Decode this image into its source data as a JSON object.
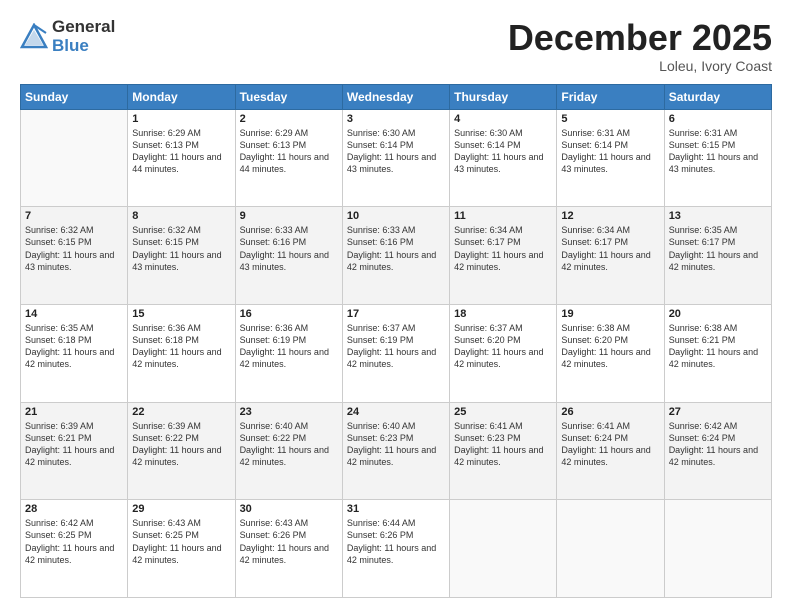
{
  "logo": {
    "general": "General",
    "blue": "Blue"
  },
  "header": {
    "month": "December 2025",
    "location": "Loleu, Ivory Coast"
  },
  "weekdays": [
    "Sunday",
    "Monday",
    "Tuesday",
    "Wednesday",
    "Thursday",
    "Friday",
    "Saturday"
  ],
  "weeks": [
    [
      {
        "day": "",
        "sunrise": "",
        "sunset": "",
        "daylight": ""
      },
      {
        "day": "1",
        "sunrise": "Sunrise: 6:29 AM",
        "sunset": "Sunset: 6:13 PM",
        "daylight": "Daylight: 11 hours and 44 minutes."
      },
      {
        "day": "2",
        "sunrise": "Sunrise: 6:29 AM",
        "sunset": "Sunset: 6:13 PM",
        "daylight": "Daylight: 11 hours and 44 minutes."
      },
      {
        "day": "3",
        "sunrise": "Sunrise: 6:30 AM",
        "sunset": "Sunset: 6:14 PM",
        "daylight": "Daylight: 11 hours and 43 minutes."
      },
      {
        "day": "4",
        "sunrise": "Sunrise: 6:30 AM",
        "sunset": "Sunset: 6:14 PM",
        "daylight": "Daylight: 11 hours and 43 minutes."
      },
      {
        "day": "5",
        "sunrise": "Sunrise: 6:31 AM",
        "sunset": "Sunset: 6:14 PM",
        "daylight": "Daylight: 11 hours and 43 minutes."
      },
      {
        "day": "6",
        "sunrise": "Sunrise: 6:31 AM",
        "sunset": "Sunset: 6:15 PM",
        "daylight": "Daylight: 11 hours and 43 minutes."
      }
    ],
    [
      {
        "day": "7",
        "sunrise": "Sunrise: 6:32 AM",
        "sunset": "Sunset: 6:15 PM",
        "daylight": "Daylight: 11 hours and 43 minutes."
      },
      {
        "day": "8",
        "sunrise": "Sunrise: 6:32 AM",
        "sunset": "Sunset: 6:15 PM",
        "daylight": "Daylight: 11 hours and 43 minutes."
      },
      {
        "day": "9",
        "sunrise": "Sunrise: 6:33 AM",
        "sunset": "Sunset: 6:16 PM",
        "daylight": "Daylight: 11 hours and 43 minutes."
      },
      {
        "day": "10",
        "sunrise": "Sunrise: 6:33 AM",
        "sunset": "Sunset: 6:16 PM",
        "daylight": "Daylight: 11 hours and 42 minutes."
      },
      {
        "day": "11",
        "sunrise": "Sunrise: 6:34 AM",
        "sunset": "Sunset: 6:17 PM",
        "daylight": "Daylight: 11 hours and 42 minutes."
      },
      {
        "day": "12",
        "sunrise": "Sunrise: 6:34 AM",
        "sunset": "Sunset: 6:17 PM",
        "daylight": "Daylight: 11 hours and 42 minutes."
      },
      {
        "day": "13",
        "sunrise": "Sunrise: 6:35 AM",
        "sunset": "Sunset: 6:17 PM",
        "daylight": "Daylight: 11 hours and 42 minutes."
      }
    ],
    [
      {
        "day": "14",
        "sunrise": "Sunrise: 6:35 AM",
        "sunset": "Sunset: 6:18 PM",
        "daylight": "Daylight: 11 hours and 42 minutes."
      },
      {
        "day": "15",
        "sunrise": "Sunrise: 6:36 AM",
        "sunset": "Sunset: 6:18 PM",
        "daylight": "Daylight: 11 hours and 42 minutes."
      },
      {
        "day": "16",
        "sunrise": "Sunrise: 6:36 AM",
        "sunset": "Sunset: 6:19 PM",
        "daylight": "Daylight: 11 hours and 42 minutes."
      },
      {
        "day": "17",
        "sunrise": "Sunrise: 6:37 AM",
        "sunset": "Sunset: 6:19 PM",
        "daylight": "Daylight: 11 hours and 42 minutes."
      },
      {
        "day": "18",
        "sunrise": "Sunrise: 6:37 AM",
        "sunset": "Sunset: 6:20 PM",
        "daylight": "Daylight: 11 hours and 42 minutes."
      },
      {
        "day": "19",
        "sunrise": "Sunrise: 6:38 AM",
        "sunset": "Sunset: 6:20 PM",
        "daylight": "Daylight: 11 hours and 42 minutes."
      },
      {
        "day": "20",
        "sunrise": "Sunrise: 6:38 AM",
        "sunset": "Sunset: 6:21 PM",
        "daylight": "Daylight: 11 hours and 42 minutes."
      }
    ],
    [
      {
        "day": "21",
        "sunrise": "Sunrise: 6:39 AM",
        "sunset": "Sunset: 6:21 PM",
        "daylight": "Daylight: 11 hours and 42 minutes."
      },
      {
        "day": "22",
        "sunrise": "Sunrise: 6:39 AM",
        "sunset": "Sunset: 6:22 PM",
        "daylight": "Daylight: 11 hours and 42 minutes."
      },
      {
        "day": "23",
        "sunrise": "Sunrise: 6:40 AM",
        "sunset": "Sunset: 6:22 PM",
        "daylight": "Daylight: 11 hours and 42 minutes."
      },
      {
        "day": "24",
        "sunrise": "Sunrise: 6:40 AM",
        "sunset": "Sunset: 6:23 PM",
        "daylight": "Daylight: 11 hours and 42 minutes."
      },
      {
        "day": "25",
        "sunrise": "Sunrise: 6:41 AM",
        "sunset": "Sunset: 6:23 PM",
        "daylight": "Daylight: 11 hours and 42 minutes."
      },
      {
        "day": "26",
        "sunrise": "Sunrise: 6:41 AM",
        "sunset": "Sunset: 6:24 PM",
        "daylight": "Daylight: 11 hours and 42 minutes."
      },
      {
        "day": "27",
        "sunrise": "Sunrise: 6:42 AM",
        "sunset": "Sunset: 6:24 PM",
        "daylight": "Daylight: 11 hours and 42 minutes."
      }
    ],
    [
      {
        "day": "28",
        "sunrise": "Sunrise: 6:42 AM",
        "sunset": "Sunset: 6:25 PM",
        "daylight": "Daylight: 11 hours and 42 minutes."
      },
      {
        "day": "29",
        "sunrise": "Sunrise: 6:43 AM",
        "sunset": "Sunset: 6:25 PM",
        "daylight": "Daylight: 11 hours and 42 minutes."
      },
      {
        "day": "30",
        "sunrise": "Sunrise: 6:43 AM",
        "sunset": "Sunset: 6:26 PM",
        "daylight": "Daylight: 11 hours and 42 minutes."
      },
      {
        "day": "31",
        "sunrise": "Sunrise: 6:44 AM",
        "sunset": "Sunset: 6:26 PM",
        "daylight": "Daylight: 11 hours and 42 minutes."
      },
      {
        "day": "",
        "sunrise": "",
        "sunset": "",
        "daylight": ""
      },
      {
        "day": "",
        "sunrise": "",
        "sunset": "",
        "daylight": ""
      },
      {
        "day": "",
        "sunrise": "",
        "sunset": "",
        "daylight": ""
      }
    ]
  ]
}
